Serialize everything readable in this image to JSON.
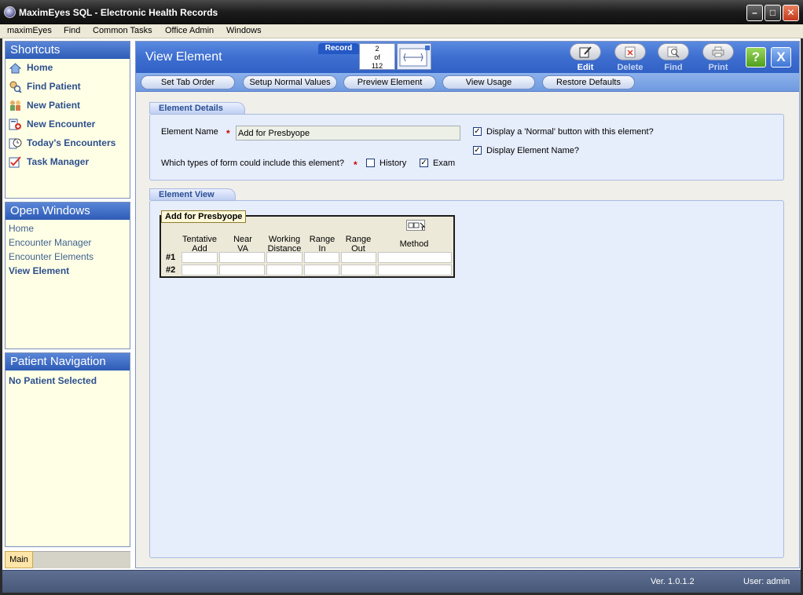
{
  "window": {
    "title": "MaximEyes SQL - Electronic Health Records"
  },
  "menu": [
    "maximEyes",
    "Find",
    "Common Tasks",
    "Office Admin",
    "Windows"
  ],
  "shortcuts": {
    "title": "Shortcuts",
    "items": [
      {
        "label": "Home",
        "icon": "home-icon"
      },
      {
        "label": "Find Patient",
        "icon": "find-patient-icon"
      },
      {
        "label": "New Patient",
        "icon": "new-patient-icon"
      },
      {
        "label": "New Encounter",
        "icon": "new-encounter-icon"
      },
      {
        "label": "Today's Encounters",
        "icon": "clock-icon"
      },
      {
        "label": "Task Manager",
        "icon": "task-manager-icon"
      }
    ]
  },
  "open_windows": {
    "title": "Open Windows",
    "items": [
      "Home",
      "Encounter Manager",
      "Encounter Elements",
      "View Element"
    ],
    "active": "View Element"
  },
  "patient_nav": {
    "title": "Patient Navigation",
    "status": "No Patient Selected"
  },
  "bottom_tab": "Main",
  "header": {
    "title": "View Element",
    "record_label": "Record",
    "record_current": "2",
    "record_of": "of",
    "record_total": "112",
    "toolbar": [
      {
        "label": "Edit",
        "icon": "edit-icon",
        "enabled": true
      },
      {
        "label": "Delete",
        "icon": "delete-icon",
        "enabled": false
      },
      {
        "label": "Find",
        "icon": "find-icon",
        "enabled": false
      },
      {
        "label": "Print",
        "icon": "print-icon",
        "enabled": false
      }
    ],
    "help_glyph": "?",
    "close_glyph": "X"
  },
  "action_buttons": [
    "Set Tab Order",
    "Setup Normal Values",
    "Preview Element",
    "View Usage",
    "Restore Defaults"
  ],
  "element_details": {
    "section_title": "Element Details",
    "name_label": "Element Name",
    "name_value": "Add for Presbyope",
    "form_types_label": "Which types of form could include this element?",
    "history_label": "History",
    "history_checked": false,
    "exam_label": "Exam",
    "exam_checked": true,
    "normal_button_label": "Display a 'Normal' button with this element?",
    "normal_button_checked": true,
    "display_name_label": "Display Element Name?",
    "display_name_checked": true
  },
  "element_view": {
    "section_title": "Element View",
    "element_title": "Add for Presbyope",
    "columns": [
      [
        "Tentative",
        "Add"
      ],
      [
        "Near",
        "VA"
      ],
      [
        "Working",
        "Distance"
      ],
      [
        "Range",
        "In"
      ],
      [
        "Range",
        "Out"
      ],
      [
        "Method"
      ]
    ],
    "rows": [
      "#1",
      "#2"
    ]
  },
  "status": {
    "version": "Ver. 1.0.1.2",
    "user": "User: admin"
  },
  "colors": {
    "accent": "#3d6ed0",
    "sidebar_bg": "#ffffe6",
    "section_bg": "#e6edfb"
  }
}
